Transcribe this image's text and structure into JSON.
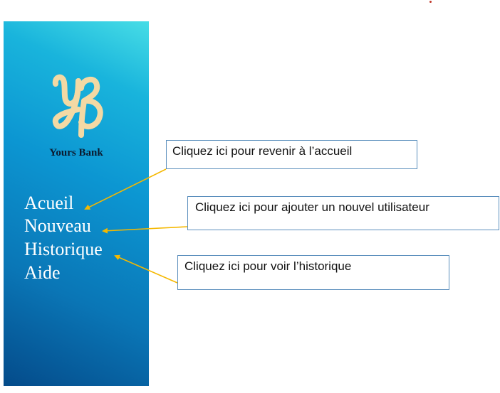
{
  "brand": {
    "logo_letters": "YB",
    "name": "Yours Bank"
  },
  "nav": {
    "items": [
      {
        "label": "Acueil"
      },
      {
        "label": "Nouveau"
      },
      {
        "label": "Historique"
      },
      {
        "label": "Aide"
      }
    ]
  },
  "callouts": [
    {
      "text": "Cliquez ici pour revenir à l’accueil"
    },
    {
      "text": "Cliquez ici pour ajouter un nouvel utilisateur"
    },
    {
      "text": "Cliquez ici pour voir l’historique"
    }
  ],
  "colors": {
    "sidebar_top": "#47dde6",
    "sidebar_bottom": "#044b8a",
    "logo": "#f3d9a4",
    "arrow": "#f5b800",
    "callout_border": "#5b8fbd"
  }
}
